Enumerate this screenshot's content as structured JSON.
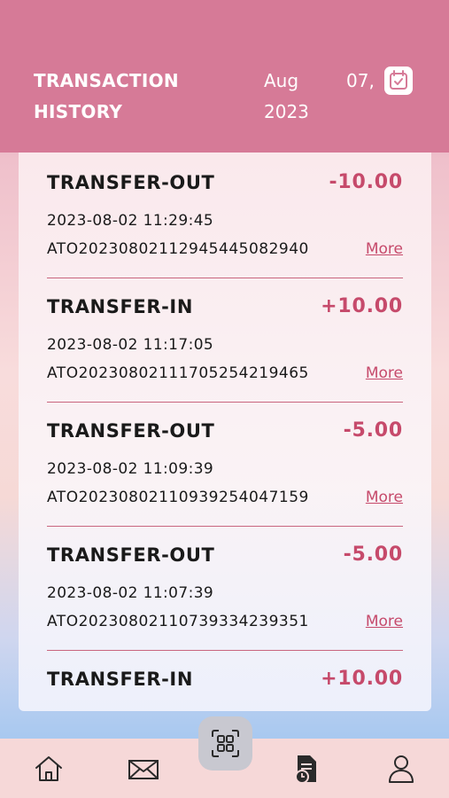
{
  "header": {
    "title_line1": "TRANSACTION",
    "title_line2": "HISTORY",
    "date_month": "Aug",
    "date_day": "07,",
    "date_year": "2023"
  },
  "transactions": [
    {
      "type": "TRANSFER-OUT",
      "amount": "-10.00",
      "time": "2023-08-02 11:29:45",
      "id": "ATO20230802112945445082940",
      "more": "More"
    },
    {
      "type": "TRANSFER-IN",
      "amount": "+10.00",
      "time": "2023-08-02 11:17:05",
      "id": "ATO20230802111705254219465",
      "more": "More"
    },
    {
      "type": "TRANSFER-OUT",
      "amount": "-5.00",
      "time": "2023-08-02 11:09:39",
      "id": "ATO20230802110939254047159",
      "more": "More"
    },
    {
      "type": "TRANSFER-OUT",
      "amount": "-5.00",
      "time": "2023-08-02 11:07:39",
      "id": "ATO20230802110739334239351",
      "more": "More"
    },
    {
      "type": "TRANSFER-IN",
      "amount": "+10.00"
    }
  ],
  "nav": {
    "items": [
      "home-icon",
      "mail-icon",
      "scan-icon",
      "transactions-icon",
      "profile-icon"
    ],
    "active": "transactions-icon"
  },
  "colors": {
    "header": "#d67a97",
    "accent": "#c64a6b",
    "text": "#1a1a1a",
    "nav_bg": "#f6d8d8"
  }
}
